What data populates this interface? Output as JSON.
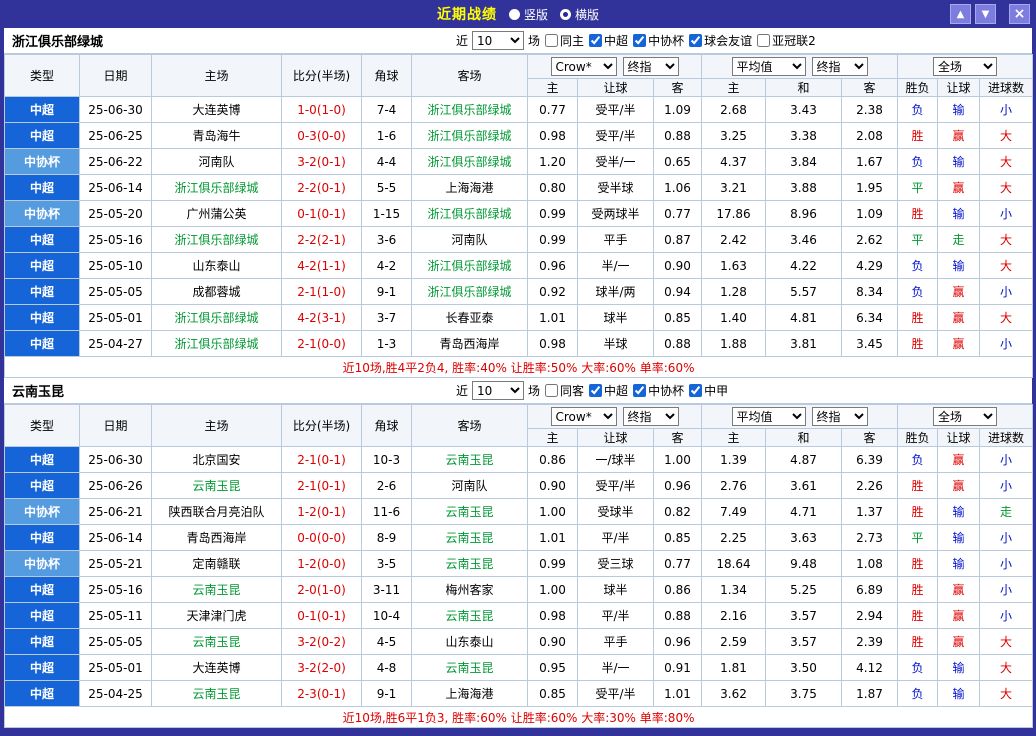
{
  "titlebar": {
    "title": "近期战绩",
    "layout_options": [
      {
        "label": "竖版",
        "selected": false
      },
      {
        "label": "横版",
        "selected": true
      }
    ],
    "up_glyph": "▲",
    "down_glyph": "▼",
    "close_glyph": "×"
  },
  "colors": {
    "titlebar_bg": "#32329b",
    "title_text": "#ffff00",
    "league_primary": "#1565d8",
    "league_secondary": "#549be0",
    "win_red": "#dd0000",
    "draw_green": "#009933",
    "lose_blue": "#0011cc",
    "team_highlight": "#009933"
  },
  "filter_labels": {
    "recent": "近",
    "count": "10",
    "games": "场"
  },
  "header": {
    "type": "类型",
    "date": "日期",
    "home": "主场",
    "score": "比分(半场)",
    "corner": "角球",
    "away": "客场",
    "company_select": "Crow*",
    "final_select": "终指",
    "average_select": "平均值",
    "final_select2": "终指",
    "scope_select": "全场",
    "odds_home": "主",
    "odds_handicap": "让球",
    "odds_away": "客",
    "avg_home": "主",
    "avg_draw": "和",
    "avg_away": "客",
    "result": "胜负",
    "handicap_result": "让球",
    "goals": "进球数"
  },
  "sections": [
    {
      "team": "浙江俱乐部绿城",
      "filters": [
        {
          "label": "同主",
          "checked": false
        },
        {
          "label": "中超",
          "checked": true
        },
        {
          "label": "中协杯",
          "checked": true
        },
        {
          "label": "球会友谊",
          "checked": true
        },
        {
          "label": "亚冠联2",
          "checked": false
        }
      ],
      "rows": [
        {
          "league": "中超",
          "date": "25-06-30",
          "home": "大连英博",
          "home_hl": false,
          "score": "1-0(1-0)",
          "corner": "7-4",
          "away": "浙江俱乐部绿城",
          "away_hl": true,
          "o1": "0.77",
          "hcp": "受平/半",
          "o2": "1.09",
          "a1": "2.68",
          "a2": "3.43",
          "a3": "2.38",
          "res": "负",
          "hres": "输",
          "gres": "小"
        },
        {
          "league": "中超",
          "date": "25-06-25",
          "home": "青岛海牛",
          "home_hl": false,
          "score": "0-3(0-0)",
          "corner": "1-6",
          "away": "浙江俱乐部绿城",
          "away_hl": true,
          "o1": "0.98",
          "hcp": "受平/半",
          "o2": "0.88",
          "a1": "3.25",
          "a2": "3.38",
          "a3": "2.08",
          "res": "胜",
          "hres": "赢",
          "gres": "大"
        },
        {
          "league": "中协杯",
          "date": "25-06-22",
          "home": "河南队",
          "home_hl": false,
          "score": "3-2(0-1)",
          "corner": "4-4",
          "away": "浙江俱乐部绿城",
          "away_hl": true,
          "o1": "1.20",
          "hcp": "受半/一",
          "o2": "0.65",
          "a1": "4.37",
          "a2": "3.84",
          "a3": "1.67",
          "res": "负",
          "hres": "输",
          "gres": "大"
        },
        {
          "league": "中超",
          "date": "25-06-14",
          "home": "浙江俱乐部绿城",
          "home_hl": true,
          "score": "2-2(0-1)",
          "corner": "5-5",
          "away": "上海海港",
          "away_hl": false,
          "o1": "0.80",
          "hcp": "受半球",
          "o2": "1.06",
          "a1": "3.21",
          "a2": "3.88",
          "a3": "1.95",
          "res": "平",
          "hres": "赢",
          "gres": "大"
        },
        {
          "league": "中协杯",
          "date": "25-05-20",
          "home": "广州蒲公英",
          "home_hl": false,
          "score": "0-1(0-1)",
          "corner": "1-15",
          "away": "浙江俱乐部绿城",
          "away_hl": true,
          "o1": "0.99",
          "hcp": "受两球半",
          "o2": "0.77",
          "a1": "17.86",
          "a2": "8.96",
          "a3": "1.09",
          "res": "胜",
          "hres": "输",
          "gres": "小"
        },
        {
          "league": "中超",
          "date": "25-05-16",
          "home": "浙江俱乐部绿城",
          "home_hl": true,
          "score": "2-2(2-1)",
          "corner": "3-6",
          "away": "河南队",
          "away_hl": false,
          "o1": "0.99",
          "hcp": "平手",
          "o2": "0.87",
          "a1": "2.42",
          "a2": "3.46",
          "a3": "2.62",
          "res": "平",
          "hres": "走",
          "gres": "大"
        },
        {
          "league": "中超",
          "date": "25-05-10",
          "home": "山东泰山",
          "home_hl": false,
          "score": "4-2(1-1)",
          "corner": "4-2",
          "away": "浙江俱乐部绿城",
          "away_hl": true,
          "o1": "0.96",
          "hcp": "半/一",
          "o2": "0.90",
          "a1": "1.63",
          "a2": "4.22",
          "a3": "4.29",
          "res": "负",
          "hres": "输",
          "gres": "大"
        },
        {
          "league": "中超",
          "date": "25-05-05",
          "home": "成都蓉城",
          "home_hl": false,
          "score": "2-1(1-0)",
          "corner": "9-1",
          "away": "浙江俱乐部绿城",
          "away_hl": true,
          "o1": "0.92",
          "hcp": "球半/两",
          "o2": "0.94",
          "a1": "1.28",
          "a2": "5.57",
          "a3": "8.34",
          "res": "负",
          "hres": "赢",
          "gres": "小"
        },
        {
          "league": "中超",
          "date": "25-05-01",
          "home": "浙江俱乐部绿城",
          "home_hl": true,
          "score": "4-2(3-1)",
          "corner": "3-7",
          "away": "长春亚泰",
          "away_hl": false,
          "o1": "1.01",
          "hcp": "球半",
          "o2": "0.85",
          "a1": "1.40",
          "a2": "4.81",
          "a3": "6.34",
          "res": "胜",
          "hres": "赢",
          "gres": "大"
        },
        {
          "league": "中超",
          "date": "25-04-27",
          "home": "浙江俱乐部绿城",
          "home_hl": true,
          "score": "2-1(0-0)",
          "corner": "1-3",
          "away": "青岛西海岸",
          "away_hl": false,
          "o1": "0.98",
          "hcp": "半球",
          "o2": "0.88",
          "a1": "1.88",
          "a2": "3.81",
          "a3": "3.45",
          "res": "胜",
          "hres": "赢",
          "gres": "小"
        }
      ],
      "summary": "近10场,胜4平2负4, 胜率:40% 让胜率:50% 大率:60% 单率:60%"
    },
    {
      "team": "云南玉昆",
      "filters": [
        {
          "label": "同客",
          "checked": false
        },
        {
          "label": "中超",
          "checked": true
        },
        {
          "label": "中协杯",
          "checked": true
        },
        {
          "label": "中甲",
          "checked": true
        }
      ],
      "rows": [
        {
          "league": "中超",
          "date": "25-06-30",
          "home": "北京国安",
          "home_hl": false,
          "score": "2-1(0-1)",
          "corner": "10-3",
          "away": "云南玉昆",
          "away_hl": true,
          "o1": "0.86",
          "hcp": "一/球半",
          "o2": "1.00",
          "a1": "1.39",
          "a2": "4.87",
          "a3": "6.39",
          "res": "负",
          "hres": "赢",
          "gres": "小"
        },
        {
          "league": "中超",
          "date": "25-06-26",
          "home": "云南玉昆",
          "home_hl": true,
          "score": "2-1(0-1)",
          "corner": "2-6",
          "away": "河南队",
          "away_hl": false,
          "o1": "0.90",
          "hcp": "受平/半",
          "o2": "0.96",
          "a1": "2.76",
          "a2": "3.61",
          "a3": "2.26",
          "res": "胜",
          "hres": "赢",
          "gres": "小"
        },
        {
          "league": "中协杯",
          "date": "25-06-21",
          "home": "陕西联合月亮泊队",
          "home_hl": false,
          "score": "1-2(0-1)",
          "corner": "11-6",
          "away": "云南玉昆",
          "away_hl": true,
          "o1": "1.00",
          "hcp": "受球半",
          "o2": "0.82",
          "a1": "7.49",
          "a2": "4.71",
          "a3": "1.37",
          "res": "胜",
          "hres": "输",
          "gres": "走"
        },
        {
          "league": "中超",
          "date": "25-06-14",
          "home": "青岛西海岸",
          "home_hl": false,
          "score": "0-0(0-0)",
          "corner": "8-9",
          "away": "云南玉昆",
          "away_hl": true,
          "o1": "1.01",
          "hcp": "平/半",
          "o2": "0.85",
          "a1": "2.25",
          "a2": "3.63",
          "a3": "2.73",
          "res": "平",
          "hres": "输",
          "gres": "小"
        },
        {
          "league": "中协杯",
          "date": "25-05-21",
          "home": "定南赣联",
          "home_hl": false,
          "score": "1-2(0-0)",
          "corner": "3-5",
          "away": "云南玉昆",
          "away_hl": true,
          "o1": "0.99",
          "hcp": "受三球",
          "o2": "0.77",
          "a1": "18.64",
          "a2": "9.48",
          "a3": "1.08",
          "res": "胜",
          "hres": "输",
          "gres": "小"
        },
        {
          "league": "中超",
          "date": "25-05-16",
          "home": "云南玉昆",
          "home_hl": true,
          "score": "2-0(1-0)",
          "corner": "3-11",
          "away": "梅州客家",
          "away_hl": false,
          "o1": "1.00",
          "hcp": "球半",
          "o2": "0.86",
          "a1": "1.34",
          "a2": "5.25",
          "a3": "6.89",
          "res": "胜",
          "hres": "赢",
          "gres": "小"
        },
        {
          "league": "中超",
          "date": "25-05-11",
          "home": "天津津门虎",
          "home_hl": false,
          "score": "0-1(0-1)",
          "corner": "10-4",
          "away": "云南玉昆",
          "away_hl": true,
          "o1": "0.98",
          "hcp": "平/半",
          "o2": "0.88",
          "a1": "2.16",
          "a2": "3.57",
          "a3": "2.94",
          "res": "胜",
          "hres": "赢",
          "gres": "小"
        },
        {
          "league": "中超",
          "date": "25-05-05",
          "home": "云南玉昆",
          "home_hl": true,
          "score": "3-2(0-2)",
          "corner": "4-5",
          "away": "山东泰山",
          "away_hl": false,
          "o1": "0.90",
          "hcp": "平手",
          "o2": "0.96",
          "a1": "2.59",
          "a2": "3.57",
          "a3": "2.39",
          "res": "胜",
          "hres": "赢",
          "gres": "大"
        },
        {
          "league": "中超",
          "date": "25-05-01",
          "home": "大连英博",
          "home_hl": false,
          "score": "3-2(2-0)",
          "corner": "4-8",
          "away": "云南玉昆",
          "away_hl": true,
          "o1": "0.95",
          "hcp": "半/一",
          "o2": "0.91",
          "a1": "1.81",
          "a2": "3.50",
          "a3": "4.12",
          "res": "负",
          "hres": "输",
          "gres": "大"
        },
        {
          "league": "中超",
          "date": "25-04-25",
          "home": "云南玉昆",
          "home_hl": true,
          "score": "2-3(0-1)",
          "corner": "9-1",
          "away": "上海海港",
          "away_hl": false,
          "o1": "0.85",
          "hcp": "受平/半",
          "o2": "1.01",
          "a1": "3.62",
          "a2": "3.75",
          "a3": "1.87",
          "res": "负",
          "hres": "输",
          "gres": "大"
        }
      ],
      "summary": "近10场,胜6平1负3, 胜率:60% 让胜率:60% 大率:30% 单率:80%"
    }
  ]
}
